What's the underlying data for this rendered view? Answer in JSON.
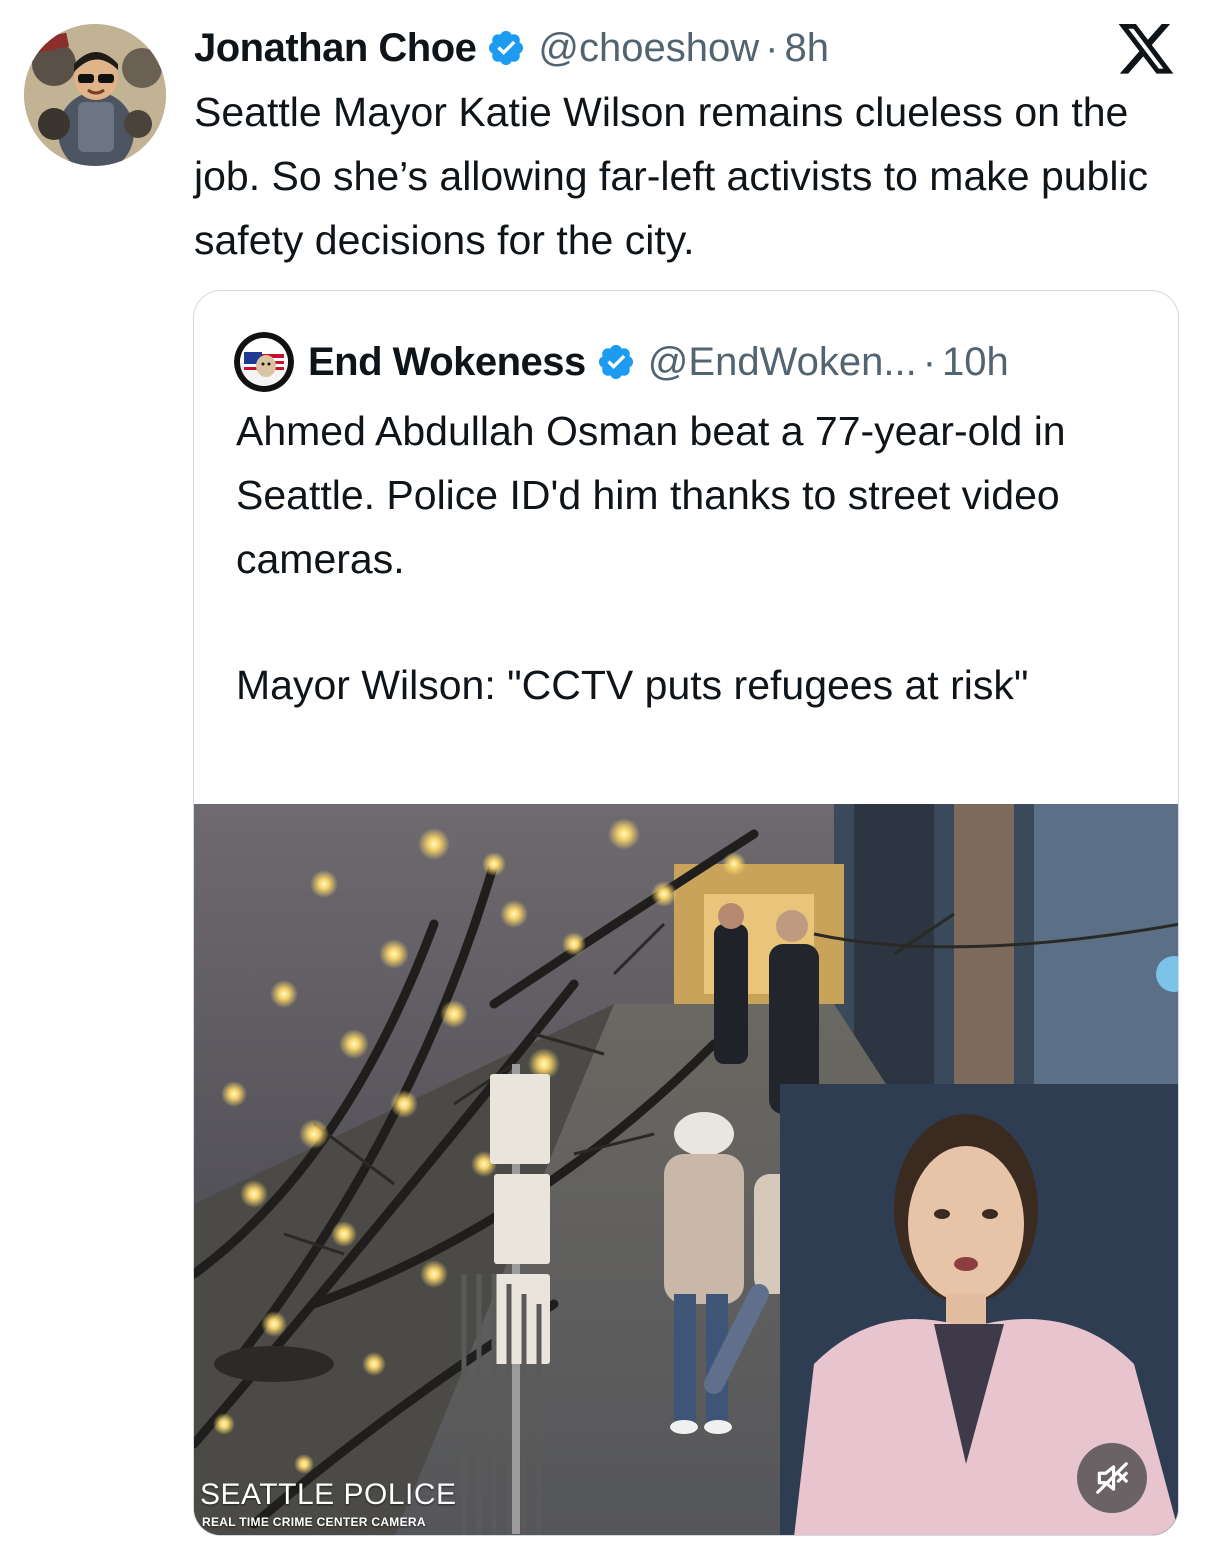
{
  "tweet": {
    "author": {
      "name": "Jonathan Choe",
      "handle": "@choeshow",
      "separator": "·",
      "time": "8h"
    },
    "text": "Seattle Mayor Katie Wilson remains clueless on the job. So she’s allowing far-left activists to make public safety decisions for the city."
  },
  "quote": {
    "author": {
      "name": "End Wokeness",
      "handle": "@EndWoken...",
      "separator": "·",
      "time": "10h"
    },
    "paragraph1": "Ahmed Abdullah Osman beat a 77-year-old in Seattle. Police ID'd him thanks to street video cameras.",
    "paragraph2": "Mayor Wilson: \"CCTV puts refugees at risk\"",
    "media": {
      "caption": "SEATTLE POLICE",
      "subcaption": "REAL TIME CRIME CENTER CAMERA",
      "mute_icon": "speaker-muted-icon"
    }
  },
  "icons": {
    "verified": "verified-badge-icon",
    "platform": "x-logo-icon"
  },
  "colors": {
    "verified_blue": "#1d9bf0",
    "secondary_text": "#536471",
    "border": "#cfd9de",
    "coat_pink": "#e8c4cf"
  }
}
